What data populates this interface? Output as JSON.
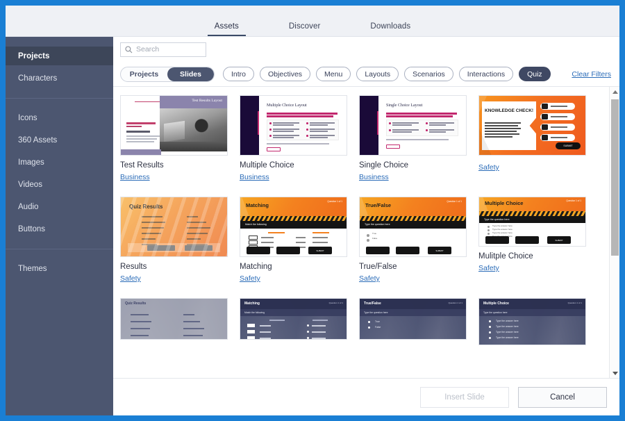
{
  "window": {
    "accent_color": "#1a7fd4"
  },
  "tabs": [
    {
      "label": "Assets",
      "active": true
    },
    {
      "label": "Discover",
      "active": false
    },
    {
      "label": "Downloads",
      "active": false
    }
  ],
  "sidebar": {
    "groups": [
      {
        "items": [
          {
            "label": "Projects",
            "active": true
          },
          {
            "label": "Characters",
            "active": false
          }
        ]
      },
      {
        "items": [
          {
            "label": "Icons",
            "active": false
          },
          {
            "label": "360 Assets",
            "active": false
          },
          {
            "label": "Images",
            "active": false
          },
          {
            "label": "Videos",
            "active": false
          },
          {
            "label": "Audio",
            "active": false
          },
          {
            "label": "Buttons",
            "active": false
          }
        ]
      },
      {
        "items": [
          {
            "label": "Themes",
            "active": false
          }
        ]
      }
    ]
  },
  "search": {
    "placeholder": "Search",
    "value": "",
    "icon": "search-icon"
  },
  "filters": {
    "segmented": [
      {
        "label": "Projects",
        "active": false
      },
      {
        "label": "Slides",
        "active": true
      }
    ],
    "chips": [
      {
        "label": "Intro",
        "active": false
      },
      {
        "label": "Objectives",
        "active": false
      },
      {
        "label": "Menu",
        "active": false
      },
      {
        "label": "Layouts",
        "active": false
      },
      {
        "label": "Scenarios",
        "active": false
      },
      {
        "label": "Interactions",
        "active": false
      },
      {
        "label": "Quiz",
        "active": true
      }
    ],
    "clear_label": "Clear Filters"
  },
  "slides": [
    {
      "title": "Test Results",
      "tag": "Business",
      "art": "test-results",
      "slide_heading": "Test Results Layout"
    },
    {
      "title": "Multiple Choice",
      "tag": "Business",
      "art": "multiple-choice-layout",
      "slide_heading": "Multiple Choice Layout"
    },
    {
      "title": "Single Choice",
      "tag": "Business",
      "art": "single-choice-layout",
      "slide_heading": "Single Choice Layout"
    },
    {
      "title": "",
      "tag": "Safety",
      "art": "knowledge-check",
      "slide_heading": "KNOWLEDGE CHECK!"
    },
    {
      "title": "Results",
      "tag": "Safety",
      "art": "quiz-results",
      "slide_heading": "Quiz Results"
    },
    {
      "title": "Matching",
      "tag": "Safety",
      "art": "matching",
      "slide_heading": "Matching"
    },
    {
      "title": "True/False",
      "tag": "Safety",
      "art": "true-false",
      "slide_heading": "True/False"
    },
    {
      "title": "Mulitple Choice",
      "tag": "Safety",
      "art": "multiple-choice",
      "slide_heading": "Multiple Choice"
    },
    {
      "title": "",
      "tag": "",
      "art": "navy-results",
      "slide_heading": "Quiz Results"
    },
    {
      "title": "",
      "tag": "",
      "art": "navy-matching",
      "slide_heading": "Matching"
    },
    {
      "title": "",
      "tag": "",
      "art": "navy-truefalse",
      "slide_heading": "True/False"
    },
    {
      "title": "",
      "tag": "",
      "art": "navy-multiple",
      "slide_heading": "Multiple Choice"
    }
  ],
  "slide_art_text": {
    "knowledge_check_body": "This space is for your quiz prompt and learner instructions. Ask a question, complete a phrase, fill in a blank, or provide a scenario statement and ask what the learner should do next.",
    "submit_label": "SUBMIT",
    "question_placeholder": "Type the question here",
    "match_instruction": "Match the following",
    "answer_placeholder": "Type the answer here",
    "true_label": "True",
    "false_label": "False",
    "question_counter": "Question 1 of 1"
  },
  "footer": {
    "insert_label": "Insert Slide",
    "insert_disabled": true,
    "cancel_label": "Cancel"
  }
}
